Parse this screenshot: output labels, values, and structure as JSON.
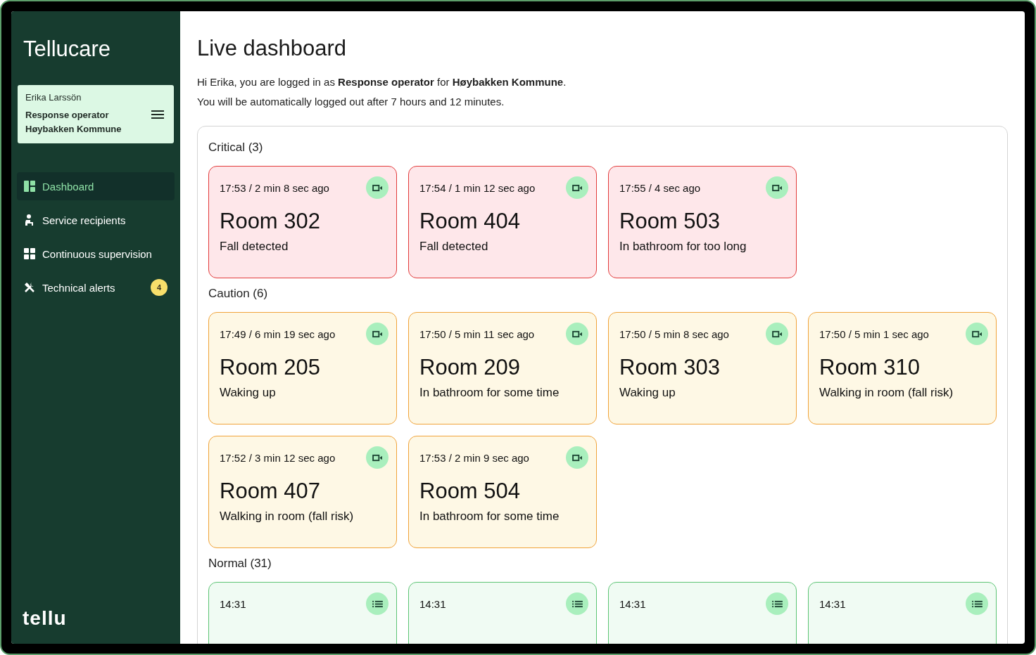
{
  "sidebar": {
    "brand": "Tellucare",
    "user": {
      "name": "Erika Larssön",
      "role": "Response operator",
      "organization": "Høybakken Kommune"
    },
    "items": [
      {
        "label": "Dashboard",
        "kind": "dashboard",
        "selected": true
      },
      {
        "label": "Service recipients",
        "kind": "recipients",
        "selected": false
      },
      {
        "label": "Continuous supervision",
        "kind": "supervision",
        "selected": false
      },
      {
        "label": "Technical alerts",
        "kind": "technical",
        "selected": false,
        "badge": "4"
      }
    ],
    "logo": "tellu"
  },
  "main": {
    "title": "Live dashboard",
    "intro": "Hi Erika, you are logged in as **Response operator** for **Høybakken Kommune**.",
    "notice": "You will be automatically logged out after 7 hours and 12 minutes.",
    "sections": [
      {
        "title": "Critical (3)",
        "kind": "critical",
        "cards": [
          {
            "time": "17:53 / 2 min 8 sec ago",
            "room": "Room 302",
            "event": "Fall detected"
          },
          {
            "time": "17:54 / 1 min 12 sec ago",
            "room": "Room 404",
            "event": "Fall detected"
          },
          {
            "time": "17:55 / 4 sec ago",
            "room": "Room 503",
            "event": "In bathroom for too long"
          }
        ]
      },
      {
        "title": "Caution (6)",
        "kind": "caution",
        "cards": [
          {
            "time": "17:49 / 6 min 19 sec ago",
            "room": "Room 205",
            "event": "Waking up"
          },
          {
            "time": "17:50 / 5 min 11 sec ago",
            "room": "Room 209",
            "event": "In bathroom for some time"
          },
          {
            "time": "17:50 / 5 min 8 sec ago",
            "room": "Room 303",
            "event": "Waking up"
          },
          {
            "time": "17:50 / 5 min 1 sec ago",
            "room": "Room 310",
            "event": "Walking in room (fall risk)"
          },
          {
            "time": "17:52 / 3 min 12 sec ago",
            "room": "Room 407",
            "event": "Walking in room (fall risk)"
          },
          {
            "time": "17:53 / 2 min 9 sec ago",
            "room": "Room 504",
            "event": "In bathroom for some time"
          }
        ]
      },
      {
        "title": "Normal (31)",
        "kind": "normal",
        "cards": [
          {
            "time": "14:31"
          },
          {
            "time": "14:31"
          },
          {
            "time": "14:31"
          },
          {
            "time": "14:31"
          }
        ]
      }
    ]
  }
}
